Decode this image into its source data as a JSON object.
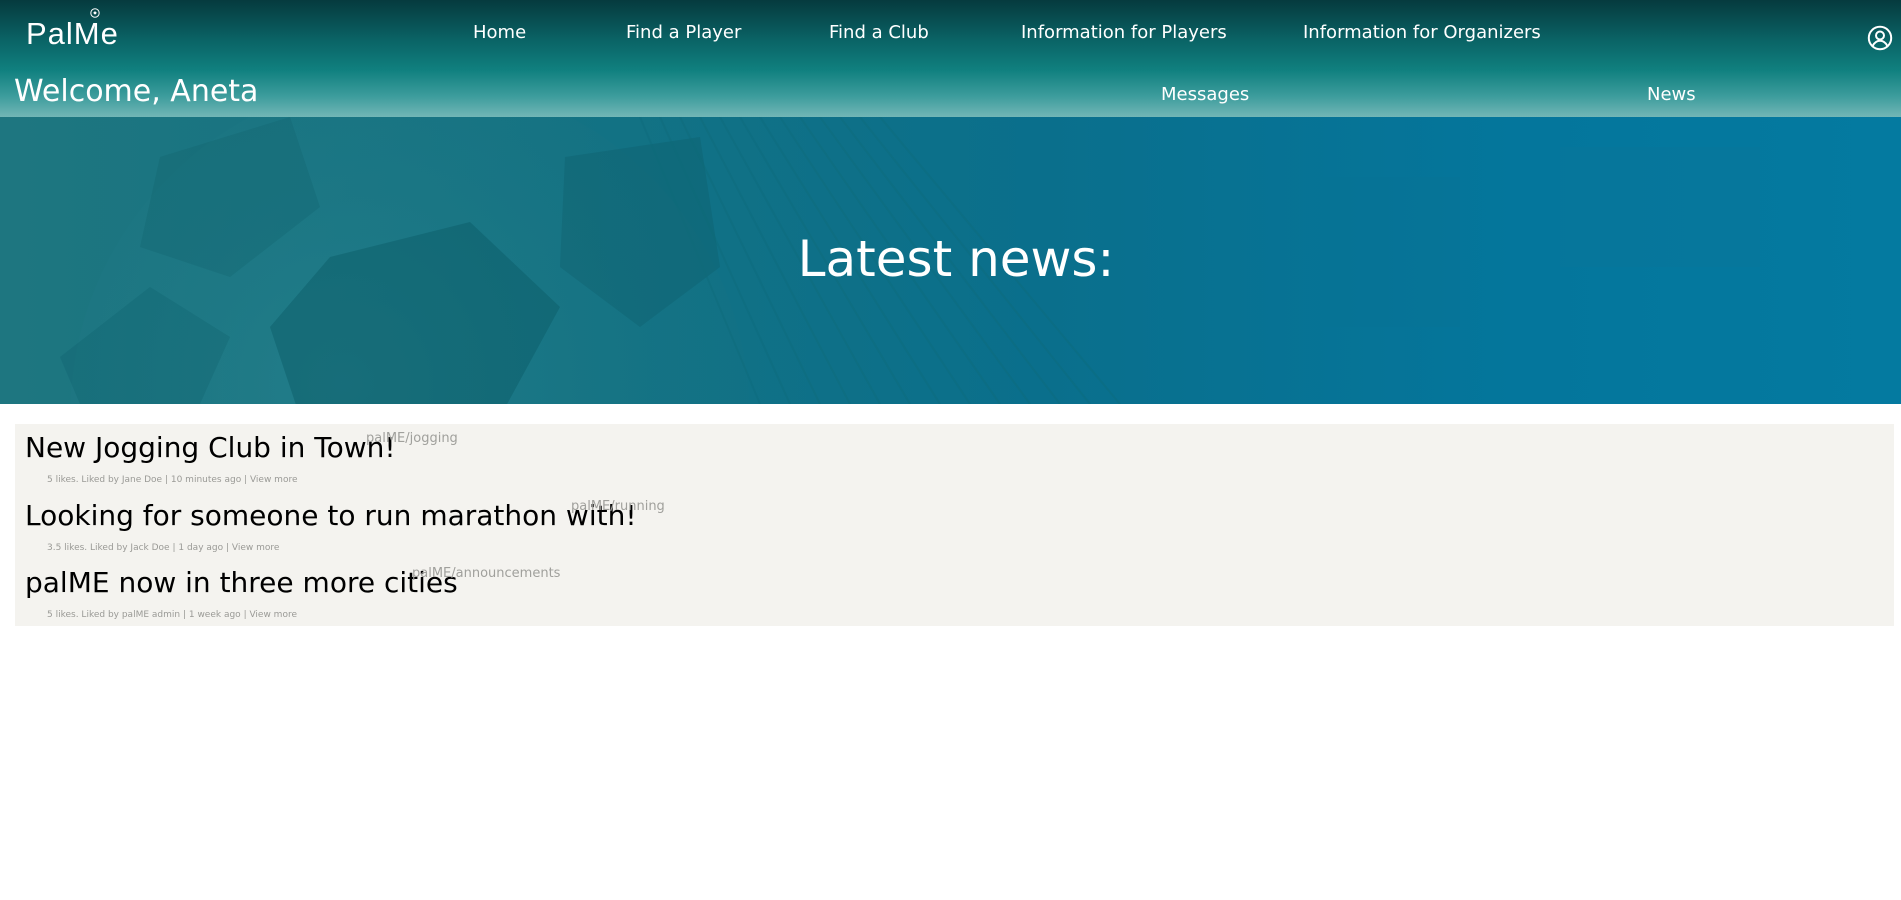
{
  "brand": {
    "logo_text": "PalMe"
  },
  "nav": {
    "items": [
      {
        "label": "Home"
      },
      {
        "label": "Find a Player"
      },
      {
        "label": "Find a Club"
      },
      {
        "label": "Information for Players"
      },
      {
        "label": "Information for Organizers"
      }
    ]
  },
  "user": {
    "welcome": "Welcome, Aneta",
    "icon": "user-circle-icon"
  },
  "subnav": {
    "items": [
      {
        "label": "Messages"
      },
      {
        "label": "News"
      }
    ]
  },
  "hero": {
    "title": "Latest news:"
  },
  "news": {
    "items": [
      {
        "title": "New Jogging Club in Town!",
        "tag": "palME/jogging",
        "likes": "5 likes. Liked by Jane Doe",
        "time": "10 minutes ago",
        "link": "View more"
      },
      {
        "title": "Looking for someone to run marathon with!",
        "tag": "palME/running",
        "likes": "3.5 likes. Liked by Jack Doe",
        "time": "1 day ago",
        "link": "View more"
      },
      {
        "title": "palME now in three more cities",
        "tag": "palME/announcements",
        "likes": "5 likes. Liked by palME admin",
        "time": "1 week ago",
        "link": "View more"
      }
    ]
  },
  "colors": {
    "header_top": "#063a3e",
    "header_bottom": "#72b6b6",
    "hero": "#0a6f8c",
    "panel": "#f4f3ef"
  }
}
